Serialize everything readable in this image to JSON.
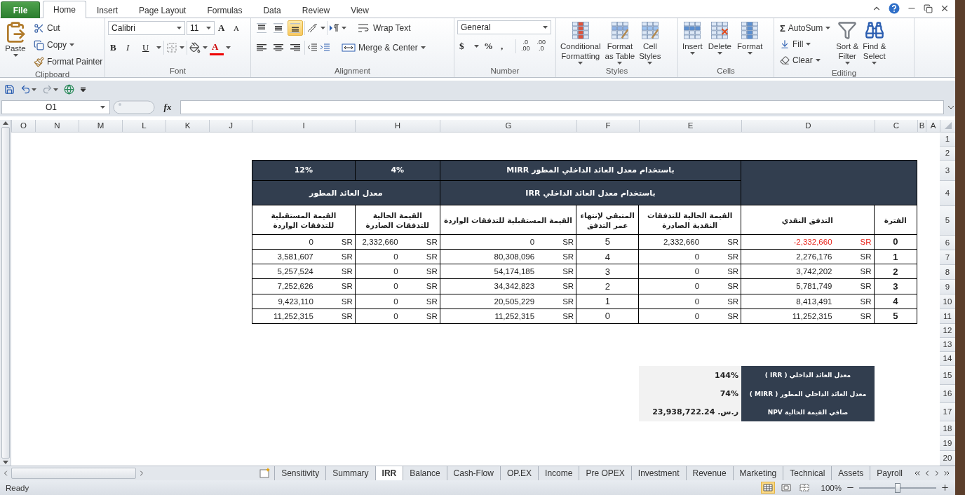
{
  "ribbon_tabs": [
    {
      "label": "File",
      "kind": "file",
      "selected": false
    },
    {
      "label": "Home",
      "kind": "tab",
      "selected": true
    },
    {
      "label": "Insert",
      "kind": "tab",
      "selected": false
    },
    {
      "label": "Page Layout",
      "kind": "tab",
      "selected": false
    },
    {
      "label": "Formulas",
      "kind": "tab",
      "selected": false
    },
    {
      "label": "Data",
      "kind": "tab",
      "selected": false
    },
    {
      "label": "Review",
      "kind": "tab",
      "selected": false
    },
    {
      "label": "View",
      "kind": "tab",
      "selected": false
    }
  ],
  "ribbon": {
    "clipboard": {
      "label": "Clipboard",
      "paste": "Paste",
      "cut": "Cut",
      "copy": "Copy",
      "format_painter": "Format Painter"
    },
    "font": {
      "label": "Font",
      "font_name": "Calibri",
      "font_size": "11",
      "grow": "A",
      "shrink": "A",
      "bold": "B",
      "italic": "I",
      "underline": "U",
      "font_color": "A"
    },
    "alignment": {
      "label": "Alignment",
      "vertical": [
        {
          "kind": "top",
          "selected": false
        },
        {
          "kind": "middle",
          "selected": false
        },
        {
          "kind": "bottom",
          "selected": true
        }
      ],
      "horizontal": [
        {
          "kind": "left",
          "selected": false
        },
        {
          "kind": "center",
          "selected": false
        },
        {
          "kind": "right",
          "selected": false
        }
      ],
      "wrap_text": "Wrap Text",
      "merge_center": "Merge & Center"
    },
    "number": {
      "label": "Number",
      "format": "General",
      "currency": "$",
      "percent": "%",
      "comma": ",",
      "increase_decimal": [
        ".0",
        ".00"
      ],
      "decrease_decimal": [
        ".00",
        ".0"
      ]
    },
    "styles": {
      "label": "Styles",
      "buttons": [
        {
          "kind": "conditional",
          "lines": [
            "Conditional",
            "Formatting"
          ]
        },
        {
          "kind": "table",
          "lines": [
            "Format",
            "as Table"
          ]
        },
        {
          "kind": "cell",
          "lines": [
            "Cell",
            "Styles"
          ]
        }
      ]
    },
    "cells": {
      "label": "Cells",
      "buttons": [
        {
          "kind": "insert",
          "lines": [
            "Insert"
          ]
        },
        {
          "kind": "delete",
          "lines": [
            "Delete"
          ]
        },
        {
          "kind": "format",
          "lines": [
            "Format"
          ]
        }
      ]
    },
    "editing": {
      "label": "Editing",
      "autosum_symbol": "Σ",
      "autosum": "AutoSum",
      "fill": "Fill",
      "clear": "Clear",
      "sort_filter": [
        "Sort &",
        "Filter"
      ],
      "find_select": [
        "Find &",
        "Select"
      ]
    }
  },
  "formula_bar": {
    "name_box": "O1",
    "function_label": "fx"
  },
  "sheet": {
    "columns": [
      "O",
      "N",
      "M",
      "L",
      "K",
      "J",
      "I",
      "H",
      "G",
      "F",
      "E",
      "D",
      "C",
      "B",
      "A"
    ],
    "rows": [
      "1",
      "2",
      "3",
      "4",
      "5",
      "6",
      "7",
      "8",
      "9",
      "10",
      "11",
      "12",
      "13",
      "14",
      "15",
      "16",
      "17",
      "18",
      "19",
      "20"
    ]
  },
  "table": {
    "mirr_title": "باستخدام معدل العائد الداخلي المطور MIRR",
    "finance_rate": "4%",
    "reinvest_rate": "12%",
    "irr_title": "باستخدام معدل العائد الداخلي IRR",
    "modified_rate_title": "معدل العائد المطور",
    "columns": [
      "الفترة",
      "التدفق النقدي",
      "القيمة الحالية للتدفقات النقدية الصادرة",
      "المتبقي لإنتهاء عمر التدفق",
      "القيمة المستقبلية للتدفقات الواردة",
      "القيمة الحالية للتدفقات الصادرة",
      "القيمة المستقبلية للتدفقات الواردة"
    ],
    "rows": [
      {
        "period": "0",
        "cash_flow": {
          "value": "-2,332,660",
          "currency": "SR",
          "negative": true
        },
        "pv_out": {
          "value": "2,332,660",
          "currency": "SR"
        },
        "remaining": "5",
        "fv_in": {
          "value": "0",
          "currency": "SR"
        },
        "pv_out_2": {
          "value": "2,332,660",
          "currency": "SR"
        },
        "fv_in_2": {
          "value": "0",
          "currency": "SR"
        }
      },
      {
        "period": "1",
        "cash_flow": {
          "value": "2,276,176",
          "currency": "SR",
          "negative": false
        },
        "pv_out": {
          "value": "0",
          "currency": "SR"
        },
        "remaining": "4",
        "fv_in": {
          "value": "80,308,096",
          "currency": "SR"
        },
        "pv_out_2": {
          "value": "0",
          "currency": "SR"
        },
        "fv_in_2": {
          "value": "3,581,607",
          "currency": "SR"
        }
      },
      {
        "period": "2",
        "cash_flow": {
          "value": "3,742,202",
          "currency": "SR",
          "negative": false
        },
        "pv_out": {
          "value": "0",
          "currency": "SR"
        },
        "remaining": "3",
        "fv_in": {
          "value": "54,174,185",
          "currency": "SR"
        },
        "pv_out_2": {
          "value": "0",
          "currency": "SR"
        },
        "fv_in_2": {
          "value": "5,257,524",
          "currency": "SR"
        }
      },
      {
        "period": "3",
        "cash_flow": {
          "value": "5,781,749",
          "currency": "SR",
          "negative": false
        },
        "pv_out": {
          "value": "0",
          "currency": "SR"
        },
        "remaining": "2",
        "fv_in": {
          "value": "34,342,823",
          "currency": "SR"
        },
        "pv_out_2": {
          "value": "0",
          "currency": "SR"
        },
        "fv_in_2": {
          "value": "7,252,626",
          "currency": "SR"
        }
      },
      {
        "period": "4",
        "cash_flow": {
          "value": "8,413,491",
          "currency": "SR",
          "negative": false
        },
        "pv_out": {
          "value": "0",
          "currency": "SR"
        },
        "remaining": "1",
        "fv_in": {
          "value": "20,505,229",
          "currency": "SR"
        },
        "pv_out_2": {
          "value": "0",
          "currency": "SR"
        },
        "fv_in_2": {
          "value": "9,423,110",
          "currency": "SR"
        }
      },
      {
        "period": "5",
        "cash_flow": {
          "value": "11,252,315",
          "currency": "SR",
          "negative": false
        },
        "pv_out": {
          "value": "0",
          "currency": "SR"
        },
        "remaining": "0",
        "fv_in": {
          "value": "11,252,315",
          "currency": "SR"
        },
        "pv_out_2": {
          "value": "0",
          "currency": "SR"
        },
        "fv_in_2": {
          "value": "11,252,315",
          "currency": "SR"
        }
      }
    ]
  },
  "summary": [
    {
      "label": "معدل العائد الداخلي ( IRR )",
      "value": "144%"
    },
    {
      "label": "معدل العائد الداخلي المطور ( MIRR )",
      "value": "74%"
    },
    {
      "label": "صافي القيمة الحالية NPV",
      "value": "ر.س. 23,938,722.24"
    }
  ],
  "sheet_tabs": [
    {
      "label": "Sensitivity",
      "selected": false
    },
    {
      "label": "Summary",
      "selected": false
    },
    {
      "label": "IRR",
      "selected": true
    },
    {
      "label": "Balance",
      "selected": false
    },
    {
      "label": "Cash-Flow",
      "selected": false
    },
    {
      "label": "OP.EX",
      "selected": false
    },
    {
      "label": "Income",
      "selected": false
    },
    {
      "label": "Pre OPEX",
      "selected": false
    },
    {
      "label": "Investment",
      "selected": false
    },
    {
      "label": "Revenue",
      "selected": false
    },
    {
      "label": "Marketing",
      "selected": false
    },
    {
      "label": "Technical",
      "selected": false
    },
    {
      "label": "Assets",
      "selected": false
    },
    {
      "label": "Payroll",
      "selected": false
    }
  ],
  "status": {
    "text": "Ready",
    "views": [
      {
        "kind": "normal",
        "selected": true
      },
      {
        "kind": "layout",
        "selected": false
      },
      {
        "kind": "break",
        "selected": false
      }
    ],
    "zoom": "100%",
    "zoom_level": {
      "level": 0.5
    }
  }
}
